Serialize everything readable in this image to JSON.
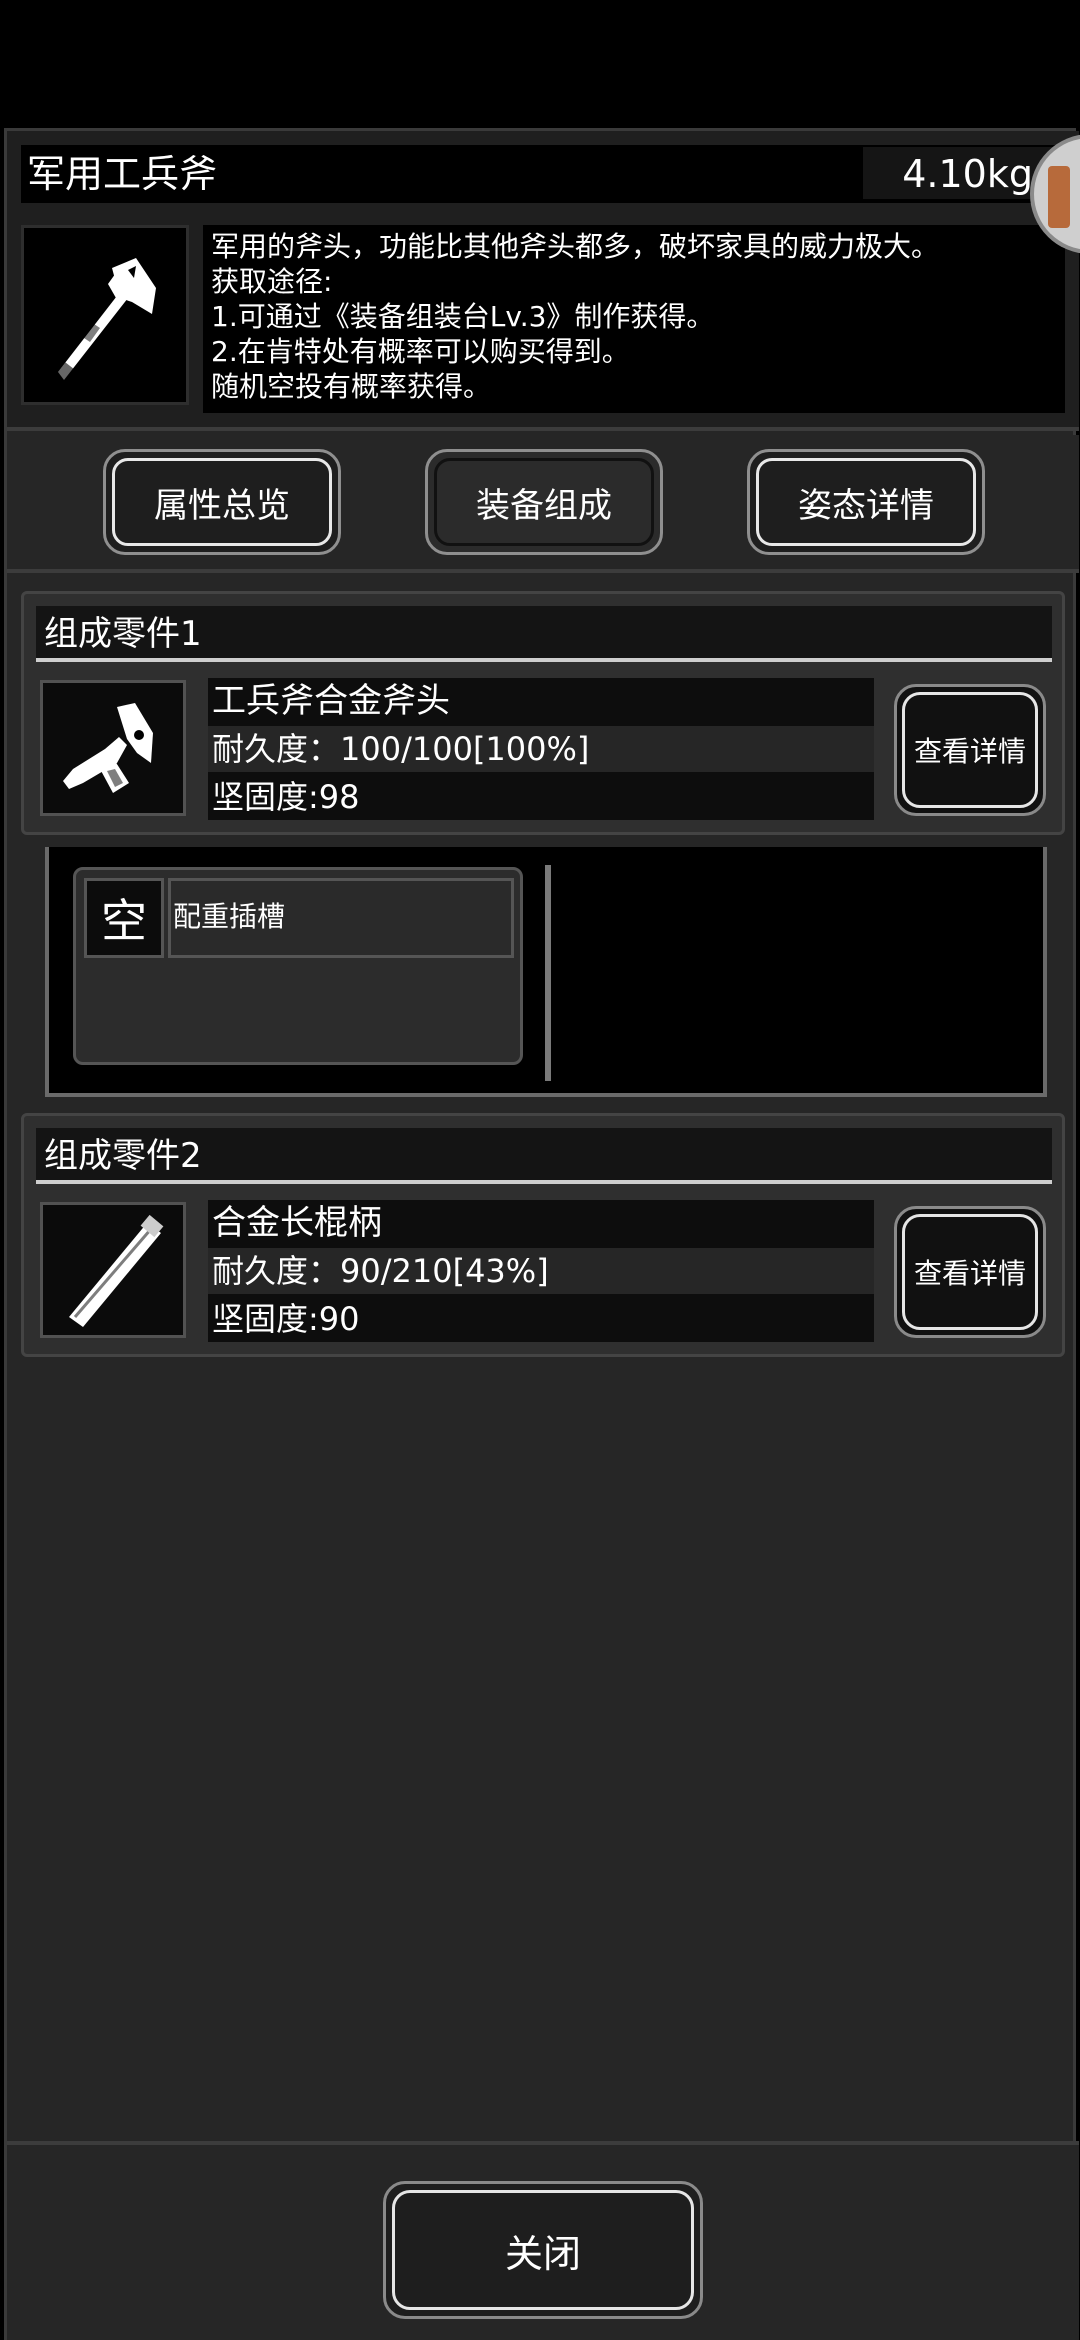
{
  "item": {
    "name": "军用工兵斧",
    "weight": "4.10kg",
    "icon": "axe-icon",
    "description": [
      "军用的斧头，功能比其他斧头都多，破坏家具的威力极大。",
      "获取途径:",
      "1.可通过《装备组装台Lv.3》制作获得。",
      "2.在肯特处有概率可以购买得到。",
      "随机空投有概率获得。"
    ]
  },
  "tabs": [
    {
      "label": "属性总览",
      "active": false
    },
    {
      "label": "装备组成",
      "active": true
    },
    {
      "label": "姿态详情",
      "active": false
    }
  ],
  "parts": [
    {
      "header": "组成零件1",
      "icon": "axe-head-icon",
      "name": "工兵斧合金斧头",
      "durability": "耐久度：100/100[100%]",
      "hardness": "坚固度:98",
      "detail_label": "查看详情"
    },
    {
      "header": "组成零件2",
      "icon": "handle-icon",
      "name": "合金长棍柄",
      "durability": "耐久度：90/210[43%]",
      "hardness": "坚固度:90",
      "detail_label": "查看详情"
    }
  ],
  "slot": {
    "empty_label": "空",
    "label": "配重插槽"
  },
  "footer": {
    "close_label": "关闭"
  }
}
